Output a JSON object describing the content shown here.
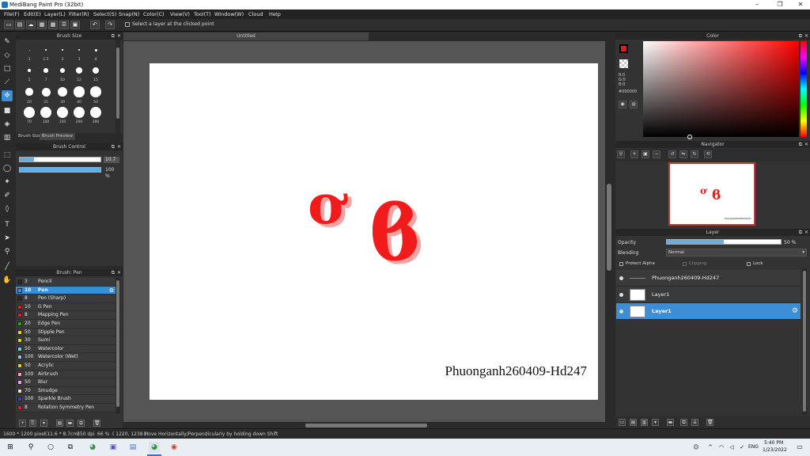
{
  "window": {
    "title": "MediBang Paint Pro (32bit)",
    "minimize": "–",
    "maximize": "❐",
    "close": "✕"
  },
  "menu": [
    "File(F)",
    "Edit(E)",
    "Layer(L)",
    "Filter(R)",
    "Select(S)",
    "Snap(N)",
    "Color(C)",
    "View(V)",
    "Tool(T)",
    "Window(W)",
    "Cloud",
    "Help"
  ],
  "toolbar": {
    "hint": "Select a layer at the clicked point",
    "undo": "↶",
    "redo": "↷"
  },
  "document": {
    "tab_title": "Untitled",
    "glyph_1": "ơ",
    "glyph_2": "ϐ",
    "watermark": "Phuonganh260409-Hd247"
  },
  "brush_size": {
    "title": "Brush Size",
    "labels": [
      "1",
      "1.5",
      "2",
      "3",
      "4",
      "5",
      "7",
      "10",
      "12",
      "15",
      "20",
      "25",
      "30",
      "40",
      "50",
      "70",
      "100",
      "150",
      "200",
      "300"
    ],
    "tab_size": "Brush Size",
    "tab_preview": "Brush Preview"
  },
  "brush_control": {
    "title": "Brush Control",
    "size_value": "10.7",
    "opacity_value": "100 %",
    "size_fraction": 0.18,
    "opacity_fraction": 1.0
  },
  "brush_list": {
    "title": "Brush: Pen",
    "items": [
      {
        "size": "3",
        "name": "Pencil",
        "color": "#2a2a2a"
      },
      {
        "size": "10",
        "name": "Pen",
        "color": "#3b8ed6"
      },
      {
        "size": "8",
        "name": "Pen (Sharp)",
        "color": "#2a2a2a"
      },
      {
        "size": "10",
        "name": "G Pen",
        "color": "#e02020"
      },
      {
        "size": "8",
        "name": "Mapping Pen",
        "color": "#e02020"
      },
      {
        "size": "20",
        "name": "Edge Pen",
        "color": "#22a022"
      },
      {
        "size": "50",
        "name": "Stipple Pen",
        "color": "#e8d020"
      },
      {
        "size": "30",
        "name": "Sumi",
        "color": "#e8d020"
      },
      {
        "size": "50",
        "name": "Watercolor",
        "color": "#70d0e8"
      },
      {
        "size": "100",
        "name": "Watercolor (Wet)",
        "color": "#70d0e8"
      },
      {
        "size": "50",
        "name": "Acrylic",
        "color": "#e8d020"
      },
      {
        "size": "100",
        "name": "Airbrush",
        "color": "#f0a0c0"
      },
      {
        "size": "50",
        "name": "Blur",
        "color": "#f0a0f0"
      },
      {
        "size": "70",
        "name": "Smudge",
        "color": "#f0e0c8"
      },
      {
        "size": "100",
        "name": "Sparkle Brush",
        "color": "#3040e0"
      },
      {
        "size": "8",
        "name": "Rotation Symmetry Pen",
        "color": "#e02020"
      }
    ]
  },
  "color_panel": {
    "title": "Color",
    "r": "R:0",
    "g": "G:0",
    "b": "B:0",
    "hex": "#000000",
    "primary": "#e02020"
  },
  "navigator": {
    "title": "Navigator"
  },
  "layer_panel": {
    "title": "Layer",
    "opacity_label": "Opacity",
    "opacity_value": "50 %",
    "opacity_fraction": 0.5,
    "blending_label": "Blending",
    "blending_value": "Normal",
    "protect_alpha": "Protect Alpha",
    "clipping": "Clipping",
    "lock": "Lock",
    "layers": [
      {
        "name": "Phuonganh260409-Hd247",
        "selected": false
      },
      {
        "name": "Layer1",
        "selected": false
      },
      {
        "name": "Layer1",
        "selected": true
      }
    ]
  },
  "status": {
    "size": "1600 * 1200 pixel",
    "physical": "(11.6 * 8.7cm)",
    "dpi": "350 dpi",
    "zoom": "66 %",
    "coords": "( 1220, 1238 )",
    "hint": "Move Horizontally/Perpendicularly by holding down Shift"
  },
  "taskbar": {
    "time": "5:40 PM",
    "date": "1/23/2022",
    "lang": "ENG"
  }
}
